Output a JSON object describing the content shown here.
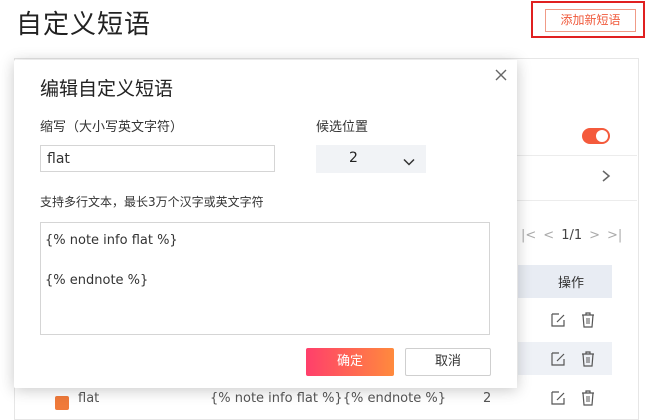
{
  "page": {
    "title": "自定义短语",
    "add_button_label": "添加新短语"
  },
  "background": {
    "pager": {
      "first": "|<",
      "prev": "<",
      "page_text": "1/1",
      "next": ">",
      "last": ">|"
    },
    "table": {
      "ops_header": "操作"
    },
    "bottom_row": {
      "phrase_abbr": "flat",
      "phrase_text": "{% note info flat %}{% endnote %}",
      "position": "2"
    },
    "colors": {
      "accent": "#f45a3c",
      "toggle_on": "#f45a3c"
    }
  },
  "dialog": {
    "title": "编辑自定义短语",
    "abbr_label": "缩写（大小写英文字符）",
    "abbr_value": "flat",
    "position_label": "候选位置",
    "position_value": "2",
    "text_label": "支持多行文本，最长3万个汉字或英文字符",
    "text_lines": [
      "{% note info flat %}",
      "",
      "{% endnote %}"
    ],
    "confirm_label": "确定",
    "cancel_label": "取消",
    "confirm_gradient": [
      "#ff3f6b",
      "#ff8a3d"
    ]
  }
}
